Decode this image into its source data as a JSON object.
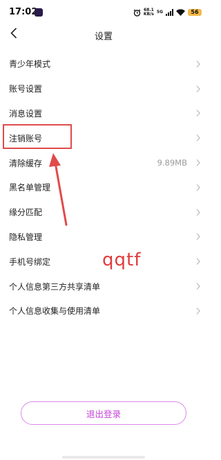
{
  "status_bar": {
    "time": "17:02",
    "net_speed_value": "68.1",
    "net_speed_unit": "KB/s",
    "network_type": "5G",
    "battery": "56"
  },
  "header": {
    "title": "设置"
  },
  "settings": {
    "items": [
      {
        "label": "青少年模式",
        "value": ""
      },
      {
        "label": "账号设置",
        "value": ""
      },
      {
        "label": "消息设置",
        "value": ""
      },
      {
        "label": "注销账号",
        "value": ""
      },
      {
        "label": "清除缓存",
        "value": "9.89MB"
      },
      {
        "label": "黑名单管理",
        "value": ""
      },
      {
        "label": "缘分匹配",
        "value": ""
      },
      {
        "label": "隐私管理",
        "value": ""
      },
      {
        "label": "手机号绑定",
        "value": ""
      },
      {
        "label": "个人信息第三方共享清单",
        "value": ""
      },
      {
        "label": "个人信息收集与使用清单",
        "value": ""
      }
    ]
  },
  "footer": {
    "logout_label": "退出登录"
  },
  "annotation": {
    "watermark_text": "qqtf",
    "color": "#e14a4a"
  },
  "colors": {
    "accent": "#c443d8",
    "accent_border": "#d98ae6",
    "battery": "#f3b94a"
  }
}
